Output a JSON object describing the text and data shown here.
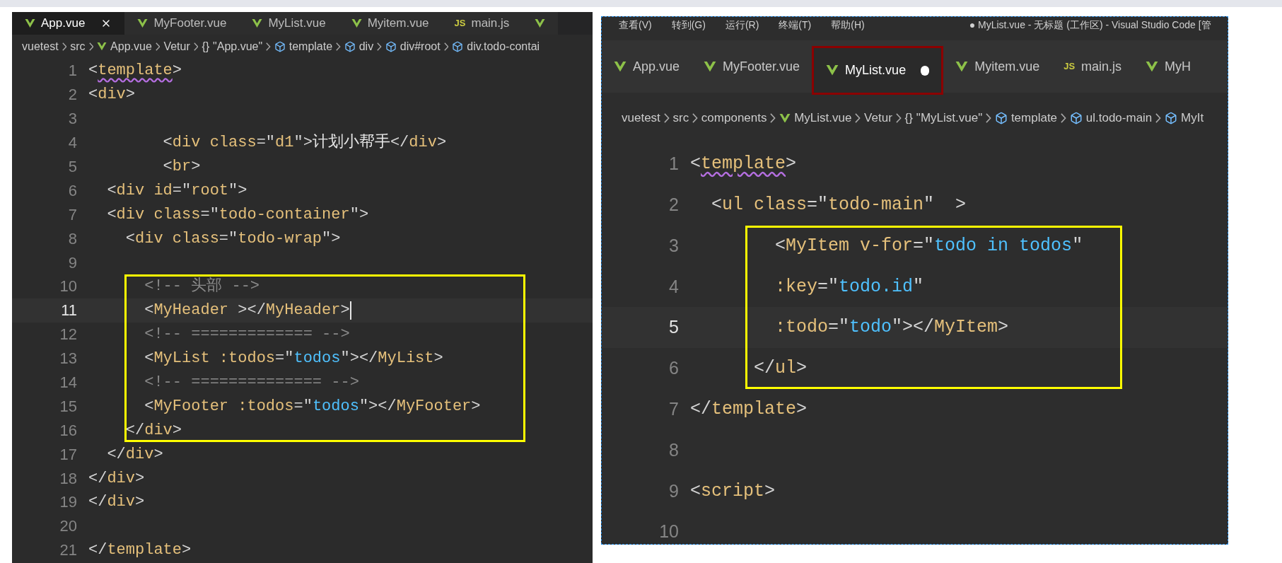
{
  "left_editor": {
    "tabs": [
      {
        "kind": "vue",
        "label": "App.vue",
        "selected": true,
        "closable": true
      },
      {
        "kind": "vue",
        "label": "MyFooter.vue",
        "selected": false,
        "closable": false
      },
      {
        "kind": "vue",
        "label": "MyList.vue",
        "selected": false,
        "closable": false
      },
      {
        "kind": "vue",
        "label": "Myitem.vue",
        "selected": false,
        "closable": false
      },
      {
        "kind": "js",
        "badge": "JS",
        "label": "main.js",
        "selected": false,
        "closable": false
      },
      {
        "kind": "vue",
        "selected": false,
        "closable": false
      }
    ],
    "breadcrumb": [
      {
        "kind": "plain",
        "label": "vuetest"
      },
      {
        "kind": "plain",
        "label": "src"
      },
      {
        "kind": "vue",
        "label": "App.vue"
      },
      {
        "kind": "plain",
        "label": "Vetur"
      },
      {
        "kind": "object",
        "glyph": "{}",
        "label": "\"App.vue\""
      },
      {
        "kind": "element",
        "label": "template"
      },
      {
        "kind": "element",
        "label": "div"
      },
      {
        "kind": "element",
        "label": "div#root"
      },
      {
        "kind": "element",
        "label": "div.todo-contai"
      }
    ],
    "lines": [
      {
        "n": "1",
        "code": [
          {
            "kind": "p",
            "text": "<"
          },
          {
            "kind": "tagw",
            "text": "template"
          },
          {
            "kind": "p",
            "text": ">"
          }
        ]
      },
      {
        "n": "2",
        "code": [
          {
            "kind": "p",
            "text": "<"
          },
          {
            "kind": "tag",
            "text": "div"
          },
          {
            "kind": "p",
            "text": ">"
          }
        ]
      },
      {
        "n": "3"
      },
      {
        "n": "4",
        "code": [
          {
            "kind": "p",
            "text": "        <"
          },
          {
            "kind": "tag",
            "text": "div"
          },
          {
            "kind": "attr",
            "text": " class"
          },
          {
            "kind": "p",
            "text": "=\""
          },
          {
            "kind": "val",
            "text": "d1"
          },
          {
            "kind": "p",
            "text": "\">"
          },
          {
            "kind": "txt",
            "text": "计划小帮手"
          },
          {
            "kind": "p",
            "text": "</"
          },
          {
            "kind": "tag",
            "text": "div"
          },
          {
            "kind": "p",
            "text": ">"
          }
        ]
      },
      {
        "n": "5",
        "code": [
          {
            "kind": "p",
            "text": "        <"
          },
          {
            "kind": "tag",
            "text": "br"
          },
          {
            "kind": "p",
            "text": ">"
          }
        ]
      },
      {
        "n": "6",
        "code": [
          {
            "kind": "p",
            "text": "  <"
          },
          {
            "kind": "tag",
            "text": "div"
          },
          {
            "kind": "attr",
            "text": " id"
          },
          {
            "kind": "p",
            "text": "=\""
          },
          {
            "kind": "val",
            "text": "root"
          },
          {
            "kind": "p",
            "text": "\">"
          }
        ]
      },
      {
        "n": "7",
        "code": [
          {
            "kind": "p",
            "text": "  <"
          },
          {
            "kind": "tag",
            "text": "div"
          },
          {
            "kind": "attr",
            "text": " class"
          },
          {
            "kind": "p",
            "text": "=\""
          },
          {
            "kind": "val",
            "text": "todo-container"
          },
          {
            "kind": "p",
            "text": "\">"
          }
        ]
      },
      {
        "n": "8",
        "code": [
          {
            "kind": "p",
            "text": "    <"
          },
          {
            "kind": "tag",
            "text": "div"
          },
          {
            "kind": "attr",
            "text": " class"
          },
          {
            "kind": "p",
            "text": "=\""
          },
          {
            "kind": "val",
            "text": "todo-wrap"
          },
          {
            "kind": "p",
            "text": "\">"
          }
        ]
      },
      {
        "n": "9"
      },
      {
        "n": "10",
        "boxed": true,
        "code": [
          {
            "kind": "cm",
            "text": "      <!-- 头部 -->"
          }
        ]
      },
      {
        "n": "11",
        "boxed": true,
        "current": true,
        "cursor": true,
        "code": [
          {
            "kind": "p",
            "text": "      <"
          },
          {
            "kind": "tag",
            "text": "MyHeader"
          },
          {
            "kind": "p",
            "text": " ></"
          },
          {
            "kind": "tag",
            "text": "MyHeader"
          },
          {
            "kind": "p",
            "text": ">"
          }
        ]
      },
      {
        "n": "12",
        "boxed": true,
        "code": [
          {
            "kind": "cm",
            "text": "      <!-- ============= -->"
          }
        ]
      },
      {
        "n": "13",
        "boxed": true,
        "code": [
          {
            "kind": "p",
            "text": "      <"
          },
          {
            "kind": "tag",
            "text": "MyList"
          },
          {
            "kind": "attr",
            "text": " :todos"
          },
          {
            "kind": "p",
            "text": "=\""
          },
          {
            "kind": "str",
            "text": "todos"
          },
          {
            "kind": "p",
            "text": "\"></"
          },
          {
            "kind": "tag",
            "text": "MyList"
          },
          {
            "kind": "p",
            "text": ">"
          }
        ]
      },
      {
        "n": "14",
        "boxed": true,
        "code": [
          {
            "kind": "cm",
            "text": "      <!-- ============== -->"
          }
        ]
      },
      {
        "n": "15",
        "boxed": true,
        "code": [
          {
            "kind": "p",
            "text": "      <"
          },
          {
            "kind": "tag",
            "text": "MyFooter"
          },
          {
            "kind": "attr",
            "text": " :todos"
          },
          {
            "kind": "p",
            "text": "=\""
          },
          {
            "kind": "str",
            "text": "todos"
          },
          {
            "kind": "p",
            "text": "\"></"
          },
          {
            "kind": "tag",
            "text": "MyFooter"
          },
          {
            "kind": "p",
            "text": ">"
          }
        ]
      },
      {
        "n": "16",
        "boxed": true,
        "code": [
          {
            "kind": "p",
            "text": "    </"
          },
          {
            "kind": "tag",
            "text": "div"
          },
          {
            "kind": "p",
            "text": ">"
          }
        ]
      },
      {
        "n": "17",
        "code": [
          {
            "kind": "p",
            "text": "  </"
          },
          {
            "kind": "tag",
            "text": "div"
          },
          {
            "kind": "p",
            "text": ">"
          }
        ]
      },
      {
        "n": "18",
        "code": [
          {
            "kind": "p",
            "text": "</"
          },
          {
            "kind": "tag",
            "text": "div"
          },
          {
            "kind": "p",
            "text": ">"
          }
        ]
      },
      {
        "n": "19",
        "code": [
          {
            "kind": "p",
            "text": "</"
          },
          {
            "kind": "tag",
            "text": "div"
          },
          {
            "kind": "p",
            "text": ">"
          }
        ]
      },
      {
        "n": "20"
      },
      {
        "n": "21",
        "code": [
          {
            "kind": "p",
            "text": "</"
          },
          {
            "kind": "tag",
            "text": "template"
          },
          {
            "kind": "p",
            "text": ">"
          }
        ]
      }
    ]
  },
  "right_editor": {
    "menu": [
      "查看(V)",
      "转到(G)",
      "运行(R)",
      "终端(T)",
      "帮助(H)"
    ],
    "title": "● MyList.vue - 无标题 (工作区) - Visual Studio Code [管",
    "tabs": [
      {
        "kind": "vue",
        "label": "App.vue",
        "selected": false,
        "modified": false,
        "boxed": false
      },
      {
        "kind": "vue",
        "label": "MyFooter.vue",
        "selected": false,
        "modified": false,
        "boxed": false
      },
      {
        "kind": "vue",
        "label": "MyList.vue",
        "selected": true,
        "modified": true,
        "boxed": true
      },
      {
        "kind": "vue",
        "label": "Myitem.vue",
        "selected": false,
        "modified": false,
        "boxed": false
      },
      {
        "kind": "js",
        "badge": "JS",
        "label": "main.js",
        "selected": false,
        "modified": false,
        "boxed": false
      },
      {
        "kind": "vue",
        "label": "MyH",
        "selected": false,
        "modified": false,
        "boxed": false
      }
    ],
    "breadcrumb": [
      {
        "kind": "plain",
        "label": "vuetest"
      },
      {
        "kind": "plain",
        "label": "src"
      },
      {
        "kind": "plain",
        "label": "components"
      },
      {
        "kind": "vue",
        "label": "MyList.vue"
      },
      {
        "kind": "plain",
        "label": "Vetur"
      },
      {
        "kind": "object",
        "glyph": "{}",
        "label": "\"MyList.vue\""
      },
      {
        "kind": "element",
        "label": "template"
      },
      {
        "kind": "element",
        "label": "ul.todo-main"
      },
      {
        "kind": "element",
        "label": "MyIt"
      }
    ],
    "lines": [
      {
        "n": "1",
        "code": [
          {
            "kind": "p",
            "text": "<"
          },
          {
            "kind": "tagw",
            "text": "template"
          },
          {
            "kind": "p",
            "text": ">"
          }
        ]
      },
      {
        "n": "2",
        "code": [
          {
            "kind": "p",
            "text": "  <"
          },
          {
            "kind": "tag",
            "text": "ul"
          },
          {
            "kind": "attr",
            "text": " class"
          },
          {
            "kind": "p",
            "text": "=\""
          },
          {
            "kind": "val",
            "text": "todo-main"
          },
          {
            "kind": "p",
            "text": "\"  >"
          }
        ]
      },
      {
        "n": "3",
        "boxed": true,
        "code": [
          {
            "kind": "p",
            "text": "        <"
          },
          {
            "kind": "tag",
            "text": "MyItem"
          },
          {
            "kind": "attr",
            "text": " v-for"
          },
          {
            "kind": "p",
            "text": "=\""
          },
          {
            "kind": "str",
            "text": "todo in todos"
          },
          {
            "kind": "p",
            "text": "\""
          }
        ]
      },
      {
        "n": "4",
        "boxed": true,
        "code": [
          {
            "kind": "attr",
            "text": "        :key"
          },
          {
            "kind": "p",
            "text": "=\""
          },
          {
            "kind": "str",
            "text": "todo.id"
          },
          {
            "kind": "p",
            "text": "\""
          }
        ]
      },
      {
        "n": "5",
        "boxed": true,
        "current": true,
        "code": [
          {
            "kind": "attr",
            "text": "        :todo"
          },
          {
            "kind": "p",
            "text": "=\""
          },
          {
            "kind": "str",
            "text": "todo"
          },
          {
            "kind": "p",
            "text": "\"></"
          },
          {
            "kind": "tag",
            "text": "MyItem"
          },
          {
            "kind": "p",
            "text": ">"
          }
        ]
      },
      {
        "n": "6",
        "boxed": true,
        "code": [
          {
            "kind": "p",
            "text": "      </"
          },
          {
            "kind": "tag",
            "text": "ul"
          },
          {
            "kind": "p",
            "text": ">"
          }
        ]
      },
      {
        "n": "7",
        "code": [
          {
            "kind": "p",
            "text": "</"
          },
          {
            "kind": "tag",
            "text": "template"
          },
          {
            "kind": "p",
            "text": ">"
          }
        ]
      },
      {
        "n": "8"
      },
      {
        "n": "9",
        "code": [
          {
            "kind": "p",
            "text": "<"
          },
          {
            "kind": "tag",
            "text": "script"
          },
          {
            "kind": "p",
            "text": ">"
          }
        ]
      },
      {
        "n": "10"
      }
    ]
  }
}
